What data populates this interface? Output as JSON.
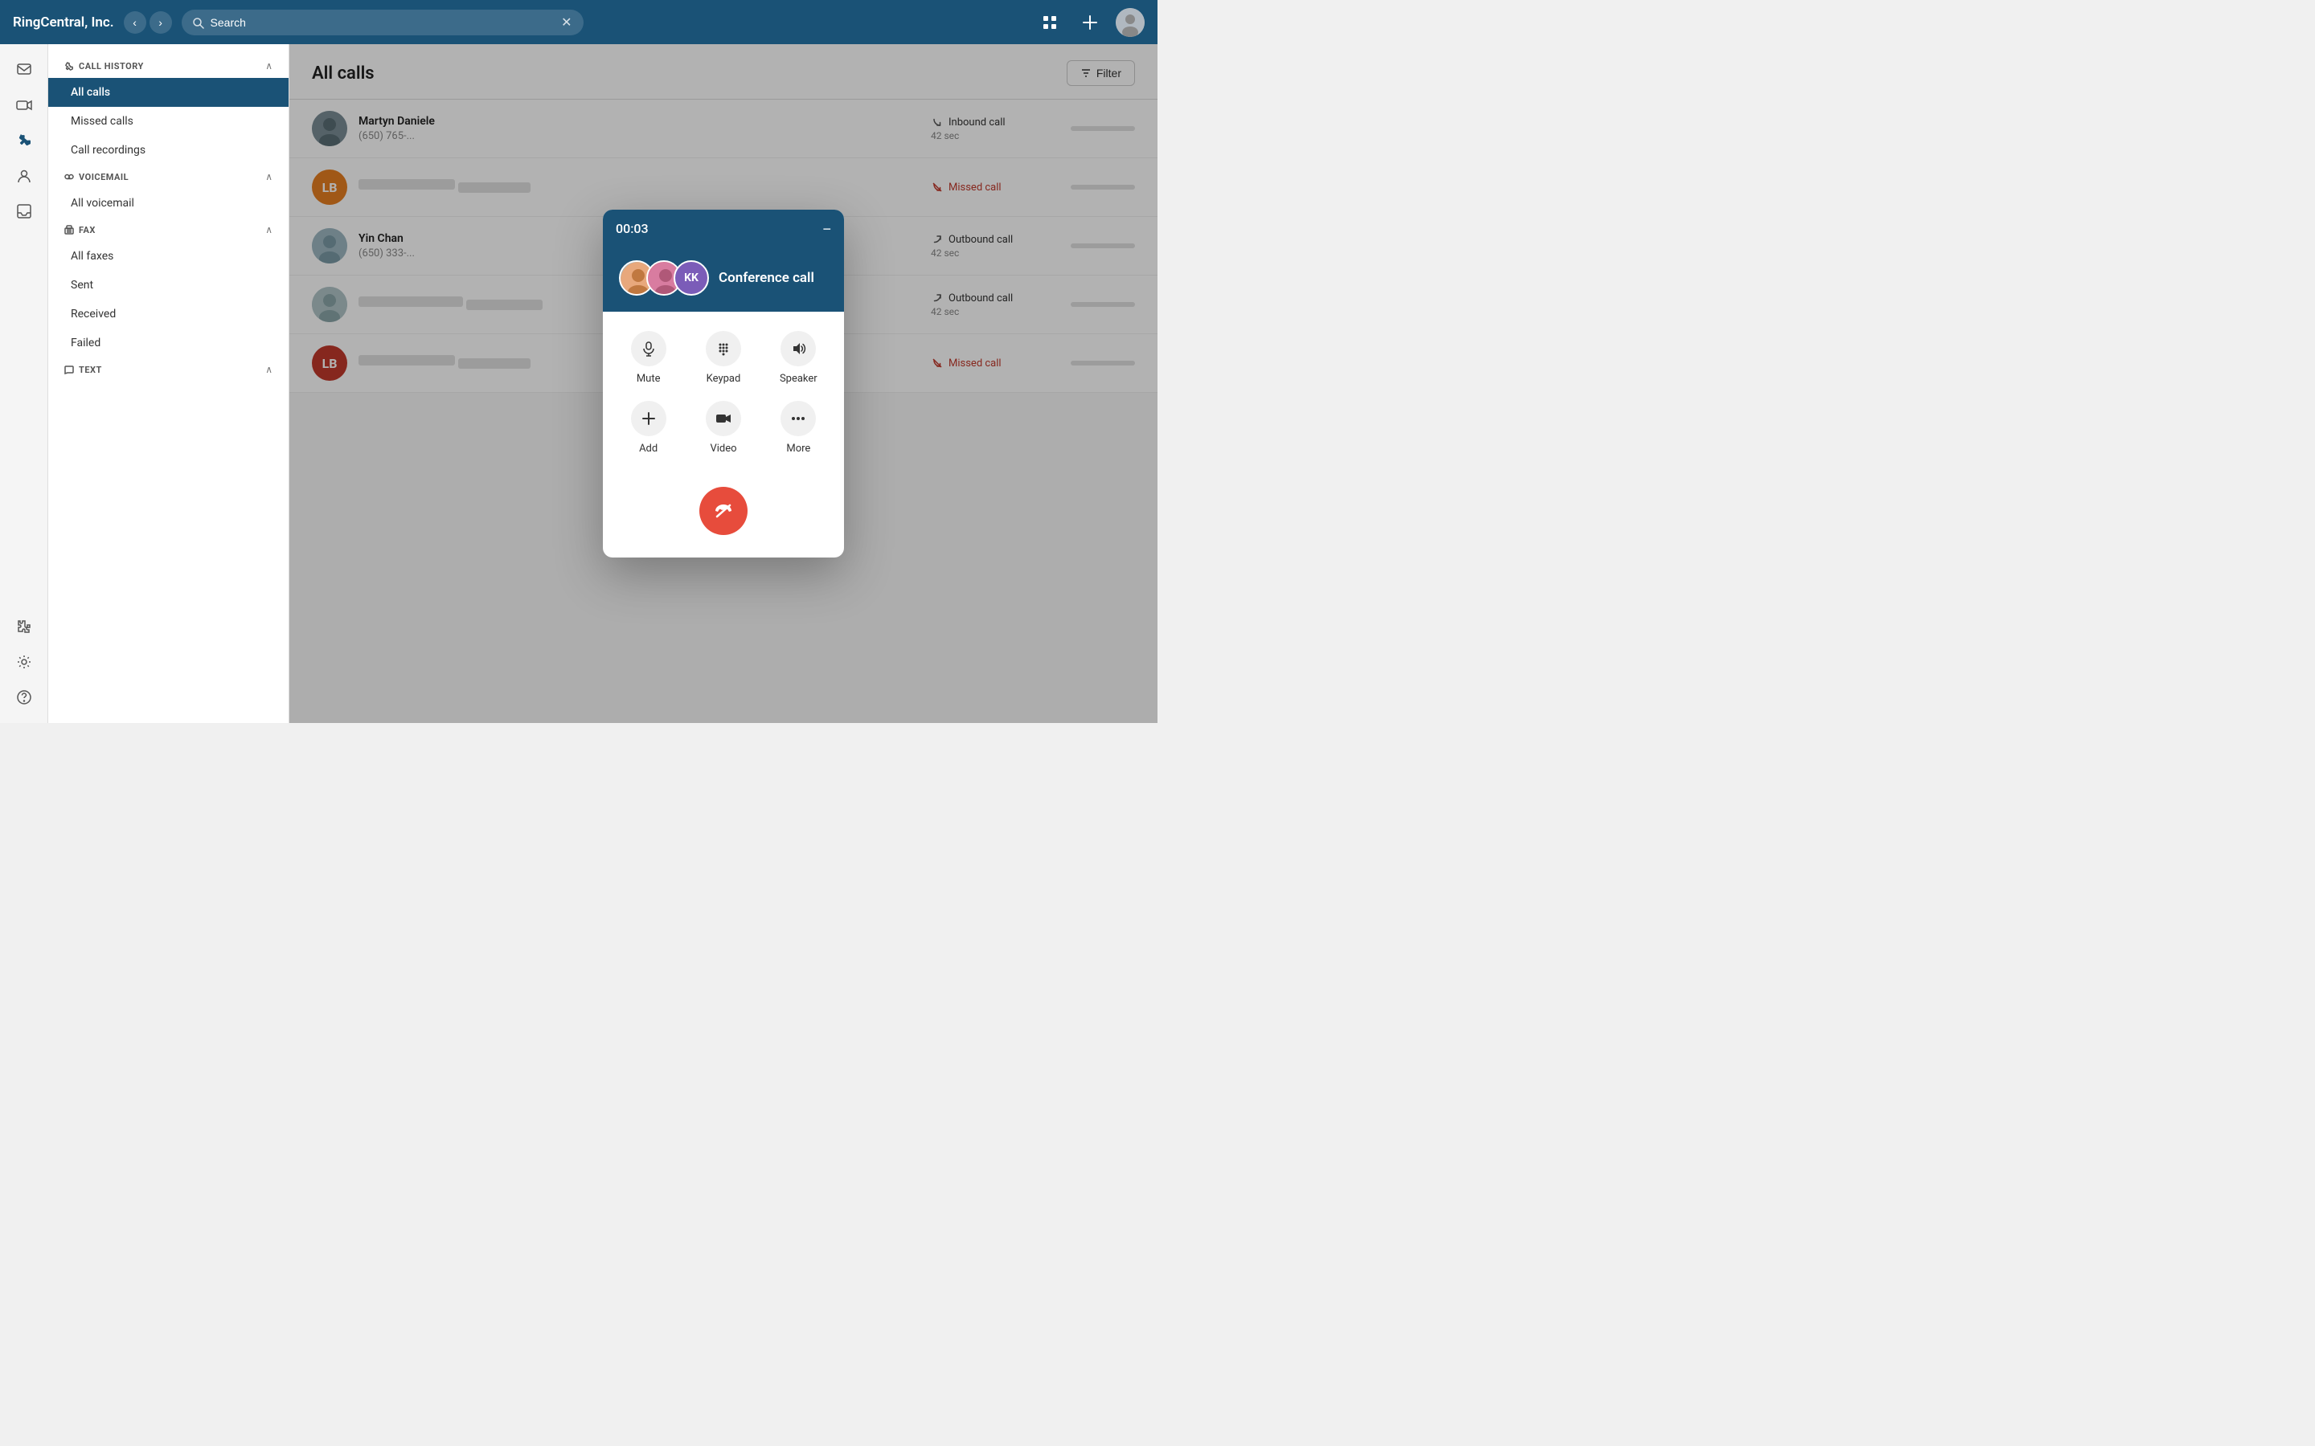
{
  "app": {
    "title": "RingCentral, Inc."
  },
  "topbar": {
    "search_placeholder": "Search",
    "search_value": "Search",
    "filter_label": "Filter",
    "add_label": "+"
  },
  "sidebar": {
    "sections": [
      {
        "id": "call-history",
        "icon": "phone-icon",
        "title": "CALL HISTORY",
        "expanded": true,
        "items": [
          {
            "id": "all-calls",
            "label": "All calls",
            "active": true
          },
          {
            "id": "missed-calls",
            "label": "Missed calls",
            "active": false
          },
          {
            "id": "call-recordings",
            "label": "Call recordings",
            "active": false
          }
        ]
      },
      {
        "id": "voicemail",
        "icon": "voicemail-icon",
        "title": "VOICEMAIL",
        "expanded": true,
        "items": [
          {
            "id": "all-voicemail",
            "label": "All voicemail",
            "active": false
          }
        ]
      },
      {
        "id": "fax",
        "icon": "fax-icon",
        "title": "FAX",
        "expanded": true,
        "items": [
          {
            "id": "all-faxes",
            "label": "All faxes",
            "active": false
          },
          {
            "id": "sent",
            "label": "Sent",
            "active": false
          },
          {
            "id": "received",
            "label": "Received",
            "active": false
          },
          {
            "id": "failed",
            "label": "Failed",
            "active": false
          }
        ]
      },
      {
        "id": "text",
        "icon": "text-icon",
        "title": "TEXT",
        "expanded": true,
        "items": []
      }
    ]
  },
  "content": {
    "title": "All calls",
    "filter_label": "Filter",
    "calls": [
      {
        "id": 1,
        "name": "Martyn Daniele",
        "number": "(650) 765-...",
        "avatar_type": "photo",
        "avatar_color": null,
        "initials": null,
        "status": "Inbound call",
        "status_type": "inbound",
        "duration": "42 sec"
      },
      {
        "id": 2,
        "name": "",
        "number": "",
        "avatar_type": "initials",
        "avatar_color": "#e67e22",
        "initials": "LB",
        "status": "Missed call",
        "status_type": "missed",
        "duration": ""
      },
      {
        "id": 3,
        "name": "Yin Chan",
        "number": "(650) 333-...",
        "avatar_type": "photo",
        "avatar_color": null,
        "initials": null,
        "status": "Outbound call",
        "status_type": "outbound",
        "duration": "42 sec"
      },
      {
        "id": 4,
        "name": "",
        "number": "",
        "avatar_type": "photo",
        "avatar_color": null,
        "initials": null,
        "status": "Outbound call",
        "status_type": "outbound",
        "duration": "42 sec"
      },
      {
        "id": 5,
        "name": "",
        "number": "",
        "avatar_type": "initials",
        "avatar_color": "#c0392b",
        "initials": "LB",
        "status": "Missed call",
        "status_type": "missed",
        "duration": ""
      }
    ]
  },
  "call_modal": {
    "timer": "00:03",
    "call_type": "Conference call",
    "controls": [
      {
        "id": "mute",
        "label": "Mute",
        "icon": "mic-icon"
      },
      {
        "id": "keypad",
        "label": "Keypad",
        "icon": "keypad-icon"
      },
      {
        "id": "speaker",
        "label": "Speaker",
        "icon": "speaker-icon"
      },
      {
        "id": "add",
        "label": "Add",
        "icon": "add-icon"
      },
      {
        "id": "video",
        "label": "Video",
        "icon": "video-icon"
      },
      {
        "id": "more",
        "label": "More",
        "icon": "more-icon"
      }
    ],
    "end_call_label": "End call"
  },
  "colors": {
    "brand_blue": "#1a5276",
    "missed_red": "#c0392b",
    "end_call_red": "#e74c3c",
    "avatar_orange": "#e67e22"
  }
}
